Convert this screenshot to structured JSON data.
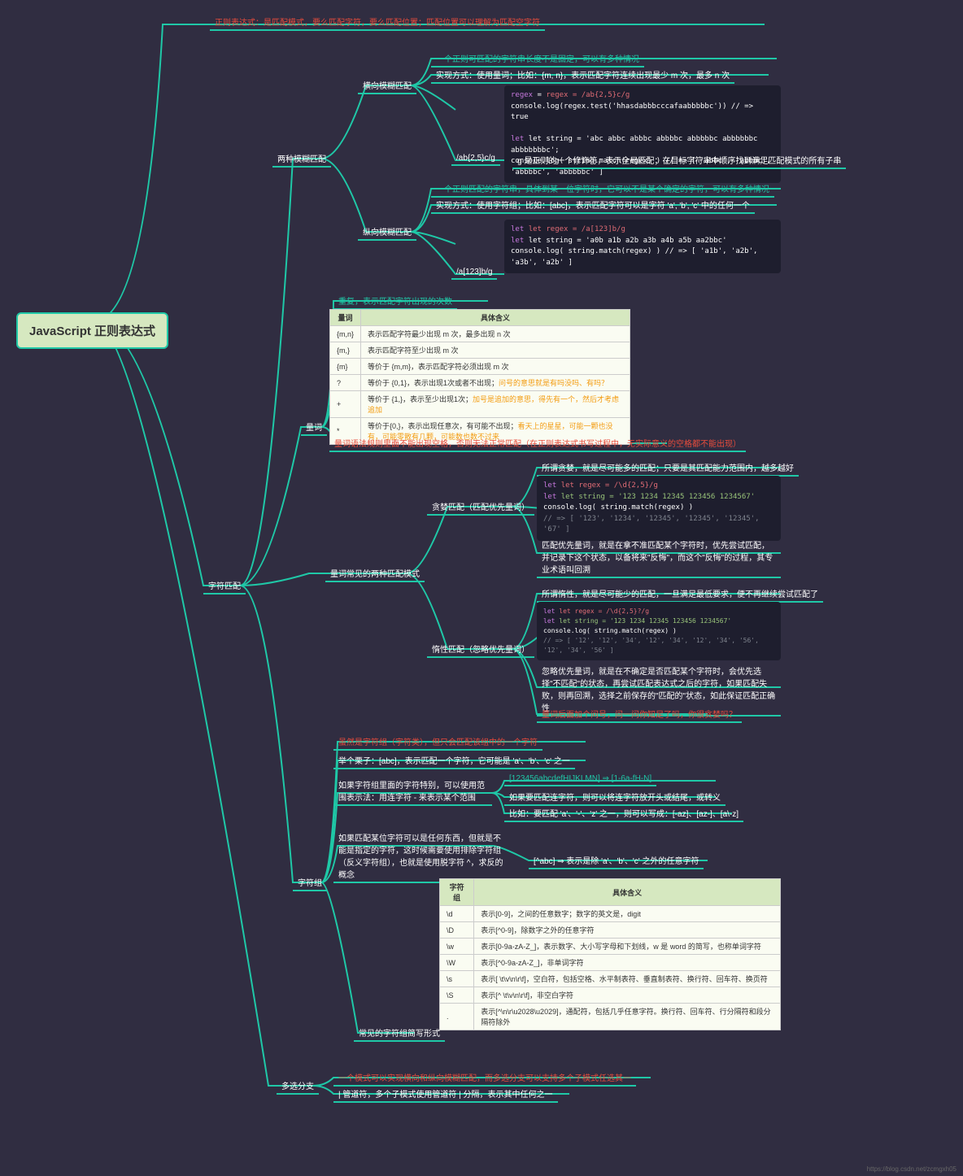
{
  "root": "JavaScript 正则表达式",
  "top_note": "正则表达式：是匹配模式，要么匹配字符，要么匹配位置；匹配位置可以理解为匹配空字符",
  "l1": {
    "char_match": "字符匹配",
    "multi_branch": "多选分支"
  },
  "l2": {
    "two_fuzzy": "两种模糊匹配",
    "quantifier": "量词",
    "two_modes": "量词常见的两种匹配模式",
    "char_group": "字符组",
    "common_shorthand": "常见的字符组简写形式"
  },
  "fuzzy": {
    "horizontal": "横向模糊匹配",
    "vertical": "纵向模糊匹配",
    "h_note1": "一个正则可匹配的字符串长度不是固定，可以有多种情况",
    "h_note2": "实现方式：使用量词；比如：{m, n}，表示匹配字符连续出现最少 m 次，最多 n 次",
    "h_code": "/ab{2,5}c/g",
    "h_code_note": "g 是正则的一个修饰符，表示全局匹配；在目标字符串中顺序找到满足匹配模式的所有子串",
    "v_note1": "一个正则匹配的字符串，具体到某一位字符时，它可以不是某个确定的字符，可以有多种情况",
    "v_note2": "实现方式：使用字符组；比如：[abc]，表示匹配字符可以是字符 'a', 'b', 'c' 中的任何一个",
    "v_code": "/a[123]b/g"
  },
  "code1": {
    "l1": "regex = /ab{2,5}c/g",
    "l2": "console.log(regex.test('hhasdabbbcccafaabbbbbc')) // => true",
    "l3": "let string = 'abc abbc abbbc abbbbc abbbbbc abbbbbbc abbbbbbbc';",
    "l4": "console.log( string.match(regex) )  // => [ 'abbc', 'abbbc', 'abbbbc', 'abbbbbc' ]"
  },
  "code2": {
    "l1": "let regex = /a[123]b/g",
    "l2": "let string = 'a0b a1b a2b a3b a4b a5b aa2bbc'",
    "l3": "console.log( string.match(regex) )  // => [ 'a1b', 'a2b', 'a3b', 'a2b' ]"
  },
  "quant": {
    "note1": "重复，表示匹配字符出现的次数",
    "note2": "量词语法规则里面不能出现空格，否则无法正常匹配（在正则表达式书写过程中，无实际意义的空格都不能出现）",
    "th1": "量词",
    "th2": "具体含义",
    "rows": [
      {
        "q": "{m,n}",
        "d": "表示匹配字符最少出现 m 次，最多出现 n 次"
      },
      {
        "q": "{m,}",
        "d": "表示匹配字符至少出现 m 次"
      },
      {
        "q": "{m}",
        "d": "等价于 {m,m}，表示匹配字符必须出现 m 次"
      },
      {
        "q": "?",
        "d": "等价于 {0,1}，表示出现1次或者不出现；",
        "extra": "问号的意思就是有吗没吗、有吗？"
      },
      {
        "q": "+",
        "d": "等价于 {1,}，表示至少出现1次；",
        "extra": "加号是追加的意思，得先有一个，然后才考虑追加"
      },
      {
        "q": "*",
        "d": "等价于{0,}，表示出现任意次，有可能不出现；",
        "extra": "看天上的星星，可能一颗也没有，可能零散有几颗，可能数也数不过来"
      }
    ]
  },
  "modes": {
    "greedy": "贪婪匹配（匹配优先量词）",
    "lazy": "惰性匹配（忽略优先量词）",
    "g_note1": "所谓贪婪，就是尽可能多的匹配；只要是其匹配能力范围内，越多越好",
    "g_note2": "匹配优先量词，就是在拿不准匹配某个字符时，优先尝试匹配，并记录下这个状态，以备将来\"反悔\"，而这个\"反悔\"的过程，其专业术语叫回溯",
    "l_note1": "所谓惰性，就是尽可能少的匹配，一旦满足最低要求，便不再继续尝试匹配了",
    "l_note2": "忽略优先量词，就是在不确定是否匹配某个字符时，会优先选择\"不匹配\"的状态，再尝试匹配表达式之后的字符，如果匹配失败，则再回溯，选择之前保存的\"匹配的\"状态，如此保证匹配正确性",
    "l_note3": "量词后面加个问号，问一问你知足了吗，你很贪婪吗？"
  },
  "code3": {
    "l1": "let regex = /\\d{2,5}/g",
    "l2": "let string = '123 1234 12345 123456 1234567'",
    "l3": "console.log( string.match(regex) )",
    "l4": "// => [ '123', '1234', '12345', '12345', '12345', '67' ]"
  },
  "code4": {
    "l1": "let regex = /\\d{2,5}?/g",
    "l2": "let string = '123 1234 12345 123456 1234567'",
    "l3": "console.log( string.match(regex) )",
    "l4": "// => [ '12', '12', '34', '12', '34', '12', '34', '56', '12', '34', '56' ]"
  },
  "chgrp": {
    "note1": "虽然是字符组（字符类），但只会匹配该组中的一个字符",
    "note2": "举个栗子：[abc]，表示匹配一个字符，它可能是 'a'、'b'、'c' 之一",
    "range_note": "如果字符组里面的字符特别，可以使用范围表示法：用连字符 - 来表示某个范围",
    "range_ex": "[123456abcdefHIJKLMN] ⇒ [1-6a-fH-N]",
    "range_note2": "如果要匹配连字符，则可以将连字符放开头或结尾，或转义",
    "range_note3": "比如：要匹配 'a'、'-'、'z' 之一，则可以写成：[-az]、[az-]、[a\\-z]",
    "neg_note": "如果匹配某位字符可以是任何东西，但就是不能是指定的字符，这时候需要使用排除字符组（反义字符组），也就是使用脱字符 ^，求反的概念",
    "neg_ex": "[^abc] ⇒ 表示是除 'a'、'b'、'c' 之外的任意字符"
  },
  "shorthand": {
    "th1": "字符组",
    "th2": "具体含义",
    "rows": [
      {
        "c": "\\d",
        "d": "表示[0-9]，之间的任意数字；数字的英文是，digit"
      },
      {
        "c": "\\D",
        "d": "表示[^0-9]，除数字之外的任意字符"
      },
      {
        "c": "\\w",
        "d": "表示[0-9a-zA-Z_]，表示数字、大小写字母和下划线，w 是 word 的简写，也称单词字符"
      },
      {
        "c": "\\W",
        "d": "表示[^0-9a-zA-Z_]，非单词字符"
      },
      {
        "c": "\\s",
        "d": "表示[ \\t\\v\\n\\r\\f]，空白符，包括空格、水平制表符、垂直制表符、换行符、回车符、换页符"
      },
      {
        "c": "\\S",
        "d": "表示[^ \\t\\v\\n\\r\\f]，非空白字符"
      },
      {
        "c": ".",
        "d": "表示[^\\n\\r\\u2028\\u2029]，通配符，包括几乎任意字符。换行符、回车符、行分隔符和段分隔符除外"
      }
    ]
  },
  "branch": {
    "note1": "一个模式可以实现横向和纵向模糊匹配，而多选分支可以支持多个子模式任选其一",
    "note2": "| 管道符，多个子模式使用管道符 | 分隔，表示其中任何之一"
  },
  "watermark": "https://blog.csdn.net/zcmgxh05"
}
